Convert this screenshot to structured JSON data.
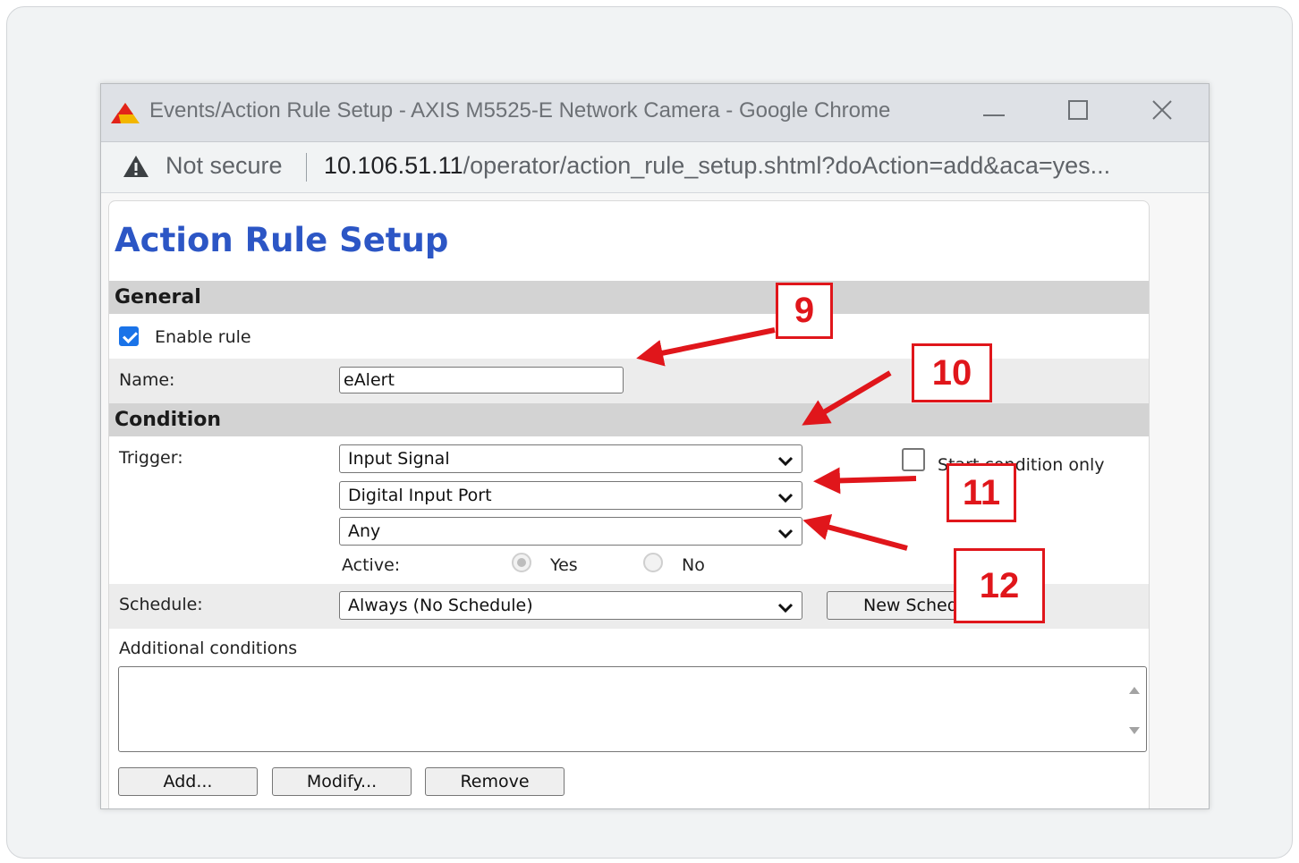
{
  "window": {
    "title": "Events/Action Rule Setup - AXIS M5525-E Network Camera - Google Chrome",
    "minimize_glyph": "—",
    "maximize_glyph": "☐",
    "close_glyph": "✕"
  },
  "addressbar": {
    "security_label": "Not secure",
    "url_host": "10.106.51.11",
    "url_path": "/operator/action_rule_setup.shtml?doAction=add&aca=yes..."
  },
  "page": {
    "title": "Action Rule Setup",
    "general": {
      "heading": "General",
      "enable_rule_label": "Enable rule",
      "enable_rule_checked": true,
      "name_label": "Name:",
      "name_value": "eAlert"
    },
    "condition": {
      "heading": "Condition",
      "trigger_label": "Trigger:",
      "trigger_value": "Input Signal",
      "trigger_sub_value": "Digital Input Port",
      "port_value": "Any",
      "start_condition_label": "Start condition only",
      "start_condition_checked": false,
      "active_label": "Active:",
      "active_yes_label": "Yes",
      "active_no_label": "No",
      "schedule_label": "Schedule:",
      "schedule_value": "Always (No Schedule)",
      "new_schedule_label": "New Schedule",
      "additional_conditions_label": "Additional conditions",
      "add_label": "Add...",
      "modify_label": "Modify...",
      "remove_label": "Remove"
    }
  },
  "callouts": [
    "9",
    "10",
    "11",
    "12"
  ],
  "colors": {
    "accent_blue": "#2c56c5",
    "callout_red": "#e0161b",
    "checkbox_blue": "#1a73e8"
  },
  "icons": [
    "axis-logo-icon",
    "minimize-icon",
    "maximize-icon",
    "close-icon",
    "warning-icon",
    "chevron-down-icon",
    "scroll-up-icon",
    "scroll-down-icon"
  ]
}
